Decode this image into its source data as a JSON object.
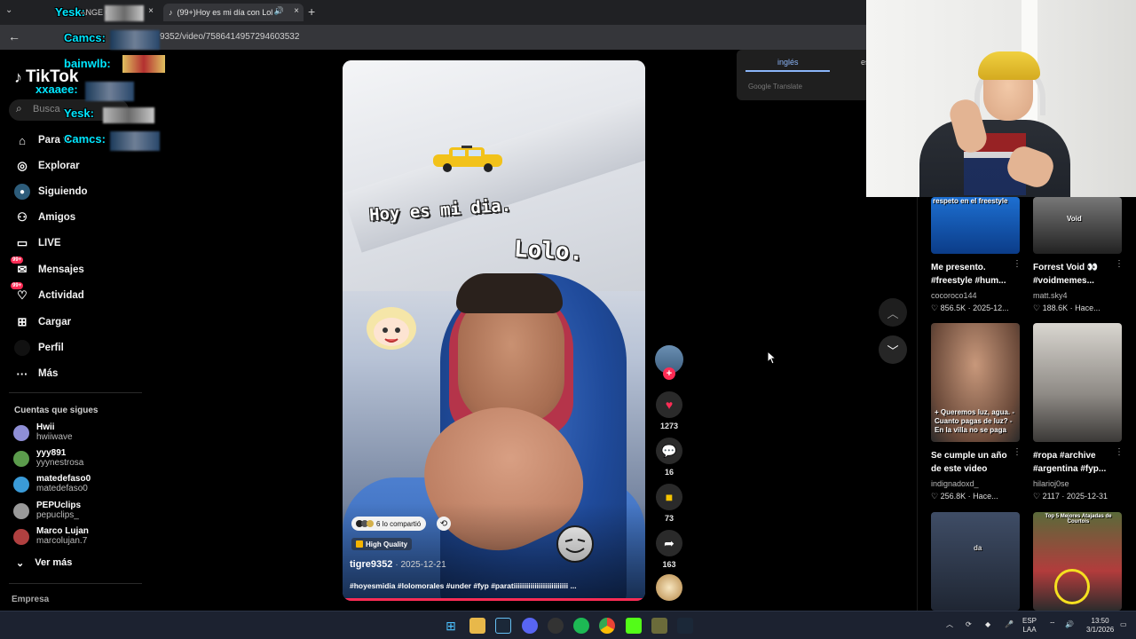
{
  "browser": {
    "tab1_title": "RANGE CHING",
    "tab2_title": "(99+)Hoy es mi día con Lol",
    "url_text": "9352/video/7586414957294603532",
    "new_tab_symbol": "+",
    "close_symbol": "×"
  },
  "chat": [
    {
      "name": "Yesk:"
    },
    {
      "name": "Camcs:"
    },
    {
      "name": "bainwlb:"
    },
    {
      "name": "xxaaee:"
    },
    {
      "name": "Yesk:"
    },
    {
      "name": "Camcs:"
    }
  ],
  "tiktok": {
    "logo": "TikTok",
    "search_placeholder": "Busca",
    "nav": [
      {
        "label": "Para ti",
        "icon": "home-icon"
      },
      {
        "label": "Explorar",
        "icon": "compass-icon"
      },
      {
        "label": "Siguiendo",
        "icon": "following-icon"
      },
      {
        "label": "Amigos",
        "icon": "friends-icon"
      },
      {
        "label": "LIVE",
        "icon": "live-icon"
      },
      {
        "label": "Mensajes",
        "icon": "messages-icon",
        "badge": "99+"
      },
      {
        "label": "Actividad",
        "icon": "activity-icon",
        "badge": "99+"
      },
      {
        "label": "Cargar",
        "icon": "upload-icon"
      },
      {
        "label": "Perfil",
        "icon": "profile-icon"
      },
      {
        "label": "Más",
        "icon": "more-icon"
      }
    ],
    "following_title": "Cuentas que sigues",
    "following": [
      {
        "name": "Hwii",
        "handle": "hwiiwave",
        "color": "#8f8fd6"
      },
      {
        "name": "yyy891",
        "handle": "yyynestrosa",
        "color": "#5b9b4c"
      },
      {
        "name": "matedefaso0",
        "handle": "matedefaso0",
        "color": "#3a9bd8"
      },
      {
        "name": "PEPUclips",
        "handle": "pepuclips_",
        "color": "#9a9a9a"
      },
      {
        "name": "Marco Lujan",
        "handle": "marcolujan.7",
        "color": "#b04040"
      }
    ],
    "see_more": "Ver más",
    "company": "Empresa"
  },
  "video": {
    "overlay_line1": "Hoy es mi dia.",
    "overlay_line2": "Lolo.",
    "shared_text": "6 lo compartió",
    "quality": "High Quality",
    "author": "tigre9352",
    "date": "· 2025-12-21",
    "caption": "#hoyesmidia #lolomorales #under #fyp #paratiiiiiiiiiiiiiiiiiiiiiiiiii ...",
    "progress": 1.0
  },
  "actions": {
    "likes": "1273",
    "comments": "16",
    "saves": "73",
    "shares": "163"
  },
  "translate": {
    "lang_a": "inglés",
    "lang_b": "es",
    "footer": "Google Translate"
  },
  "recommendations": [
    {
      "overlay": "respeto en el freestyle",
      "title": "Me presento. #freestyle #hum...",
      "author": "cocoroco144",
      "meta": "856.5K · 2025-12..."
    },
    {
      "overlay": "Void",
      "title": "Forrest Void 👀 #voidmemes...",
      "author": "matt.sky4",
      "meta": "188.6K · Hace..."
    },
    {
      "overlay": "+ Queremos luz, agua. - Cuanto pagas de luz? - En la villa no se paga",
      "title": "Se cumple un año de este video",
      "author": "indignadoxd_",
      "meta": "256.8K · Hace..."
    },
    {
      "overlay": "",
      "title": "#ropa #archive #argentina #fyp...",
      "author": "hilarioj0se",
      "meta": "2117 · 2025-12-31"
    },
    {
      "overlay": "da",
      "title": "",
      "author": "",
      "meta": ""
    },
    {
      "overlay": "Top 5 Mejores Atajadas de Courtois",
      "title": "",
      "author": "",
      "meta": ""
    }
  ],
  "taskbar": {
    "lang": "ESP",
    "lang2": "LAA",
    "time": "13:50",
    "date": "3/1/2026"
  },
  "colors": {
    "accent": "#fe2c55",
    "chat_cyan": "#00e6ff",
    "link_blue": "#8ab4f8"
  }
}
